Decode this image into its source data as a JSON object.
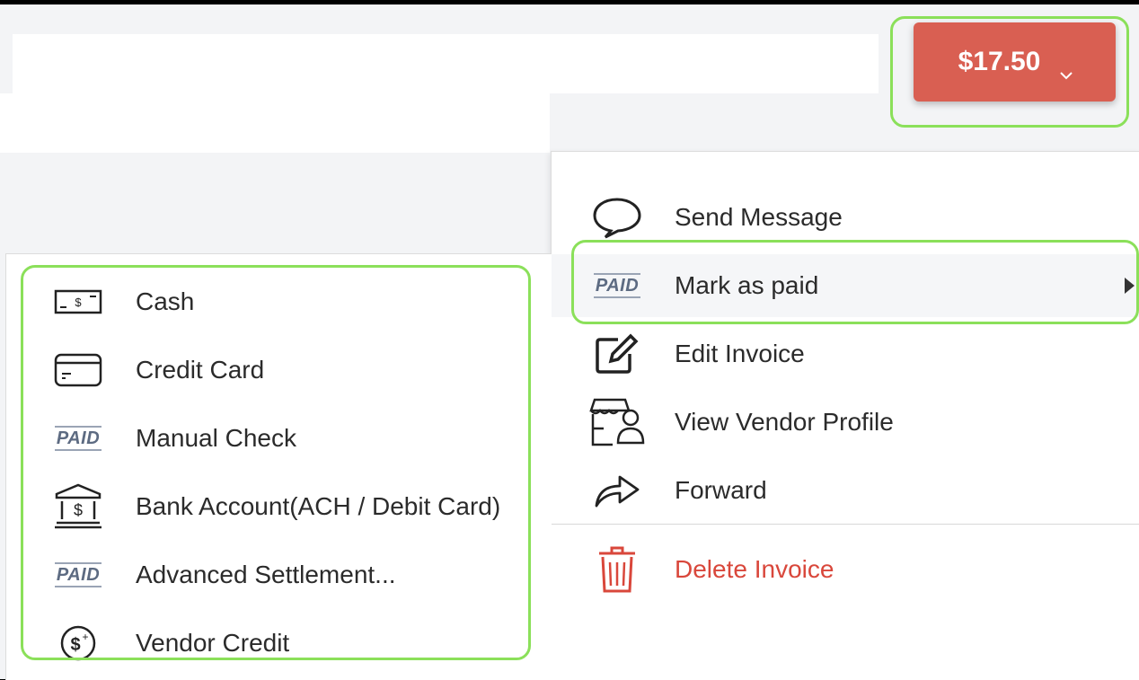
{
  "header": {
    "amount_button": "$17.50",
    "colors": {
      "accent": "#d95f52",
      "highlight": "#8be05a"
    }
  },
  "main_menu": {
    "items": [
      {
        "label": "Send Message",
        "icon": "speech-bubble-icon"
      },
      {
        "label": "Mark as paid",
        "icon": "paid-icon"
      },
      {
        "label": "Edit Invoice",
        "icon": "edit-icon"
      },
      {
        "label": "View Vendor Profile",
        "icon": "vendor-profile-icon"
      },
      {
        "label": "Forward",
        "icon": "forward-icon"
      }
    ],
    "delete_label": "Delete Invoice",
    "paid_tag": "PAID"
  },
  "payment_menu": {
    "items": [
      {
        "label": "Cash",
        "icon": "cash-icon"
      },
      {
        "label": "Credit Card",
        "icon": "credit-card-icon"
      },
      {
        "label": "Manual Check",
        "icon": "paid-icon"
      },
      {
        "label": "Bank Account(ACH / Debit Card)",
        "icon": "bank-icon"
      },
      {
        "label": "Advanced Settlement...",
        "icon": "paid-icon"
      },
      {
        "label": "Vendor Credit",
        "icon": "vendor-credit-icon"
      }
    ],
    "paid_tag": "PAID"
  }
}
